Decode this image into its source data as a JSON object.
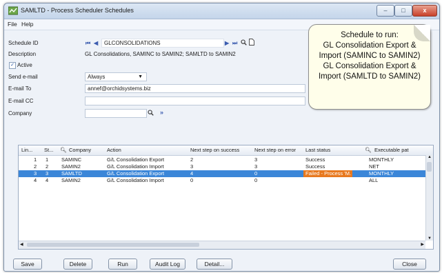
{
  "window": {
    "title": "SAMLTD - Process Scheduler Schedules",
    "controls": [
      "–",
      "□",
      "x"
    ]
  },
  "menu": [
    "File",
    "Help"
  ],
  "form": {
    "schedule_id_label": "Schedule ID",
    "schedule_id_value": "GLCONSOLIDATIONS",
    "description_label": "Description",
    "description_value": "GL Consolidations, SAMINC to SAMIN2; SAMLTD to SAMIN2",
    "active_label": "Active",
    "send_email_label": "Send e-mail",
    "send_email_value": "Always",
    "email_to_label": "E-mail To",
    "email_to_value": "annef@orchidsystems.biz",
    "email_cc_label": "E-mail CC",
    "company_label": "Company"
  },
  "callout": {
    "lines": [
      "Schedule to run:",
      "GL Consolidation Export &",
      "Import (SAMINC to SAMIN2)",
      "GL Consolidation Export &",
      "Import (SAMLTD to SAMIN2)"
    ]
  },
  "grid": {
    "headers": [
      "Lin...",
      "St...",
      "Company",
      "Action",
      "Next step on success",
      "Next step on error",
      "Last status",
      "Executable pat"
    ],
    "rows": [
      {
        "line": "1",
        "step": "1",
        "company": "SAMINC",
        "action": "G/L Consolidation Export",
        "next_success": "2",
        "next_error": "3",
        "last_status": "Success",
        "executable": "MONTHLY"
      },
      {
        "line": "2",
        "step": "2",
        "company": "SAMIN2",
        "action": "G/L Consolidation Import",
        "next_success": "3",
        "next_error": "3",
        "last_status": "Success",
        "executable": "NET"
      },
      {
        "line": "3",
        "step": "3",
        "company": "SAMLTD",
        "action": "G/L Consolidation Export",
        "next_success": "4",
        "next_error": "0",
        "last_status": "Failed - Process 'M...",
        "executable": "MONTHLY"
      },
      {
        "line": "4",
        "step": "4",
        "company": "SAMIN2",
        "action": "G/L Consolidation Import",
        "next_success": "0",
        "next_error": "0",
        "last_status": "",
        "executable": "ALL"
      }
    ],
    "selected_row": 3,
    "status_colors": {
      "failed": "#e8791f",
      "selected": "#3b86d8"
    }
  },
  "buttons": {
    "save": "Save",
    "delete": "Delete",
    "run": "Run",
    "audit_log": "Audit Log",
    "detail": "Detail...",
    "close": "Close"
  }
}
